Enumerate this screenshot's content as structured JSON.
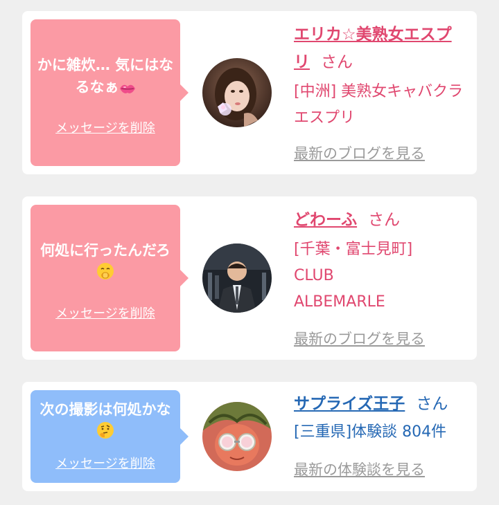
{
  "cards": [
    {
      "message": "かに雑炊… 気にはなるなぁ",
      "delete_label": "メッセージを削除",
      "name": "エリカ☆美熟女エスプリ",
      "san": "さん",
      "shop": "[中洲] 美熟女キャバクラ エスプリ",
      "latest_link": "最新のブログを見る",
      "bubble_color": "#fb9aa4",
      "accent_color": "#e0476f"
    },
    {
      "message": "何処に行ったんだろ",
      "delete_label": "メッセージを削除",
      "name": "どわーふ",
      "san": "さん",
      "shop": "[千葉・富士見町] CLUB ALBEMARLE",
      "latest_link": "最新のブログを見る",
      "bubble_color": "#fb9aa4",
      "accent_color": "#e0476f"
    },
    {
      "message": "次の撮影は何処かな",
      "delete_label": "メッセージを削除",
      "name": "サプライズ王子",
      "san": "さん",
      "shop": "[三重県]体験談 804件",
      "latest_link": "最新の体験談を見る",
      "bubble_color": "#8fbdfa",
      "accent_color": "#2568b4"
    }
  ],
  "icons": {
    "lips": "lips-emoji-icon",
    "giggle": "giggle-face-emoji-icon",
    "thinking": "thinking-face-emoji-icon"
  }
}
